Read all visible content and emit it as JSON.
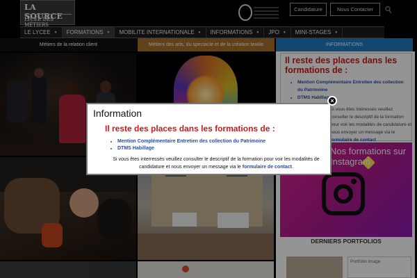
{
  "header": {
    "logo_line1": "LA SOURCE",
    "logo_line2": "LYCÉE DES MÉTIERS",
    "btn_candidature": "Candidature",
    "btn_contact": "Nous Contacter"
  },
  "nav": {
    "items": [
      {
        "label": "LE LYCEE",
        "has_caret": true
      },
      {
        "label": "FORMATIONS",
        "has_caret": true
      },
      {
        "label": "MOBILITE INTERNATIONALE",
        "has_caret": true
      },
      {
        "label": "INFORMATIONS",
        "has_caret": true
      },
      {
        "label": "JPO",
        "has_caret": true
      },
      {
        "label": "MINI-STAGES",
        "has_caret": true
      }
    ],
    "caret": "▼"
  },
  "categories": [
    {
      "label": "Métiers de la relation client",
      "color": "#111111"
    },
    {
      "label": "Métiers des arts, du spectacle et de la création textile",
      "color": "#a96e2a"
    },
    {
      "label": "INFORMATIONS",
      "color": "#1f7ac0"
    }
  ],
  "sidebar_info": {
    "title": "Il reste des places dans les formations de :",
    "items": [
      "Mention Complémentaire Entretien des collection du Patrimoine",
      "DTMS Habillage"
    ],
    "text_visible": "Si vous êtes intéressés veuillez consulter le descriptif de la formation pour voir les modalités de candidature et nous envoyer un message via le",
    "link": "formulaire de contact"
  },
  "instagram": {
    "title": "Nos formations sur Instagram",
    "icon": "instagram-icon"
  },
  "portfolios": {
    "title": "DERNIERS PORTFOLIOS",
    "caption": "Portfolio image"
  },
  "modal": {
    "title": "Information",
    "subtitle": "Il reste des places dans les formations de :",
    "items": [
      "Mention Complémentaire Entretien des collection du Patrimoine",
      "DTMS Habillage"
    ],
    "text": "Si vous êtes interressés veuillez consulter le descriptif de la formation pour voir les modalités de candidature et nous envoyer un message via le",
    "link": "formulaire de contact",
    "close": "×"
  },
  "colors": {
    "accent_red": "#c41c1c",
    "link_blue": "#2b4aa5",
    "info_blue": "#1f7ac0",
    "arts_gold": "#a96e2a"
  }
}
